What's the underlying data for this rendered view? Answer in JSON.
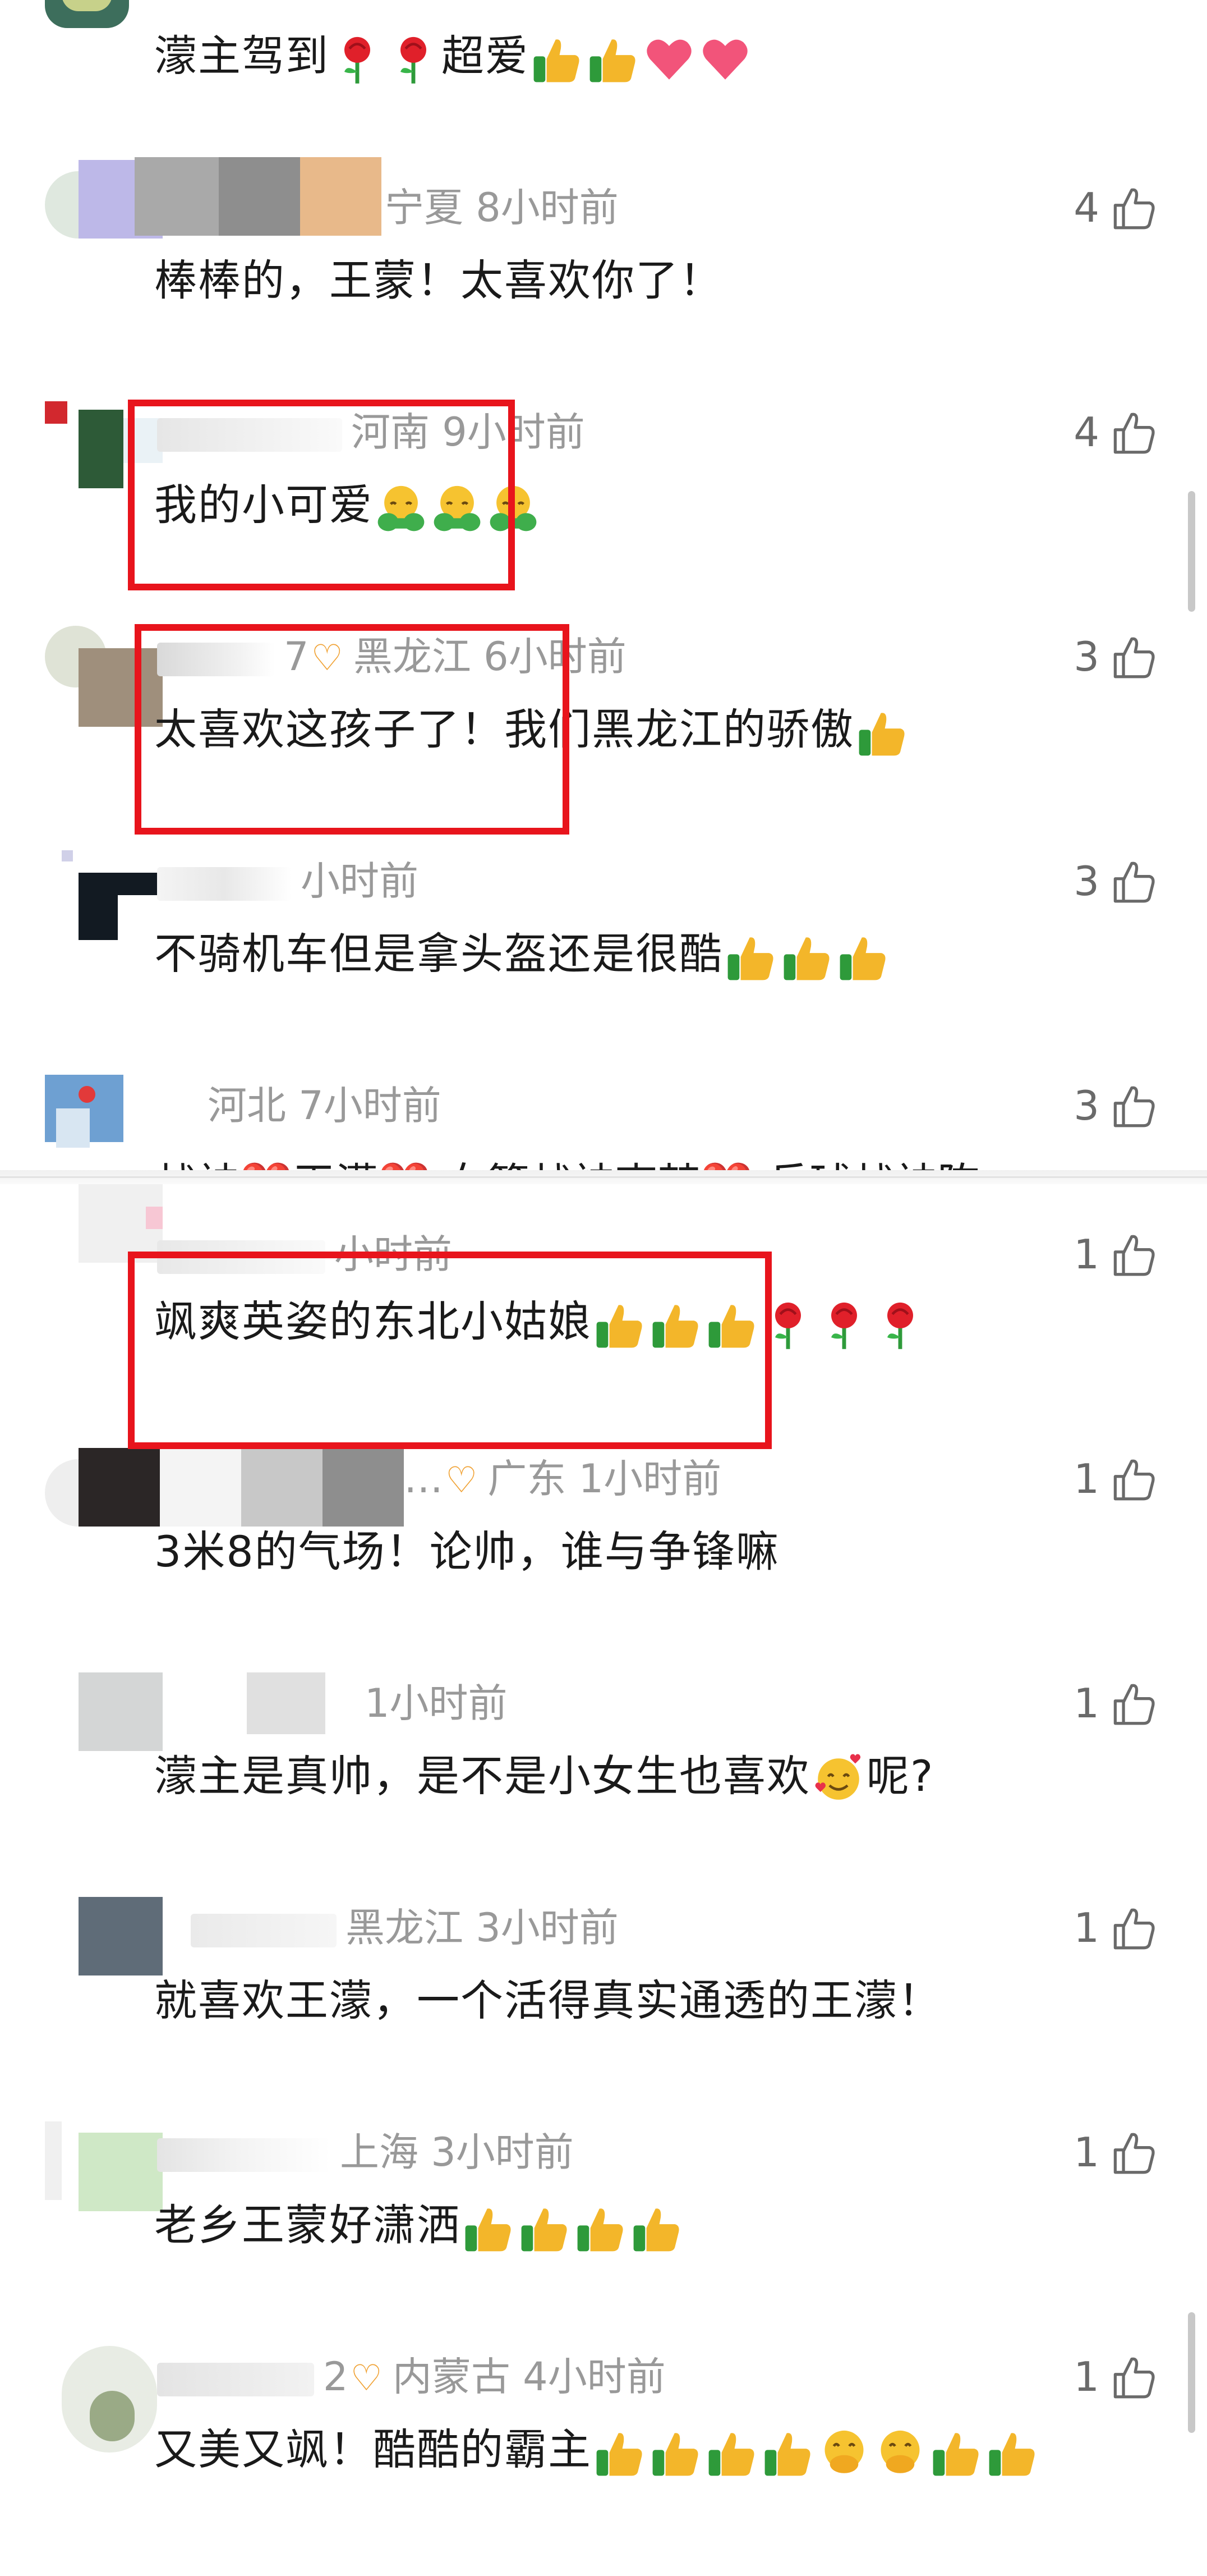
{
  "comments_top": [
    {
      "meta_suffix": "",
      "text": "濛主驾到🌹🌹超爱👍👍❤️❤️",
      "likes": ""
    },
    {
      "meta_suffix": "宁夏 8小时前",
      "text": "棒棒的，王蒙！太喜欢你了！",
      "likes": "4"
    },
    {
      "meta_suffix": "河南 9小时前",
      "text": "我的小可爱🤗🤗🤗",
      "likes": "4"
    },
    {
      "meta_suffix": "黑龙江 6小时前",
      "text": "太喜欢这孩子了！我们黑龙江的骄傲👍",
      "likes": "3"
    },
    {
      "meta_suffix": "小时前",
      "text": "不骑机车但是拿头盔还是很酷👍👍👍",
      "likes": "3"
    },
    {
      "meta_suffix": "河北 7小时前",
      "text": "战神❤️王濛❤️ 女篮战神李梦❤️ 乒球战神陈",
      "likes": "3"
    }
  ],
  "comments_bottom": [
    {
      "meta_suffix": "小时前",
      "text": "飒爽英姿的东北小姑娘👍👍👍🌹🌹🌹",
      "likes": "1"
    },
    {
      "meta_suffix": "广东 1小时前",
      "text": "3米8的气场！论帅，谁与争锋嘛",
      "likes": "1"
    },
    {
      "meta_suffix": "1小时前",
      "text": "濛主是真帅，是不是小女生也喜欢🥰呢?",
      "likes": "1"
    },
    {
      "meta_suffix": "黑龙江 3小时前",
      "text": "就喜欢王濛，一个活得真实通透的王濛！",
      "likes": "1"
    },
    {
      "meta_suffix": "上海 3小时前",
      "text": "老乡王蒙好潇洒👍👍👍👍",
      "likes": "1"
    },
    {
      "meta_suffix": "内蒙古 4小时前",
      "text": "又美又飒！酷酷的霸主👍👍👍👍🤭🤭👍👍",
      "likes": "1"
    }
  ],
  "fragments": {
    "c4_name_tail": "7",
    "c9_name_tail": "…",
    "c13_name_tail": "2"
  },
  "colors": {
    "highlight_box": "#e8141c",
    "meta_text": "#999999",
    "comment_text": "#1a1a1a",
    "badge": "#f0a030"
  },
  "icons": {
    "like": "thumbs-up-outline-icon",
    "badge": "heart-knot-badge-icon"
  }
}
